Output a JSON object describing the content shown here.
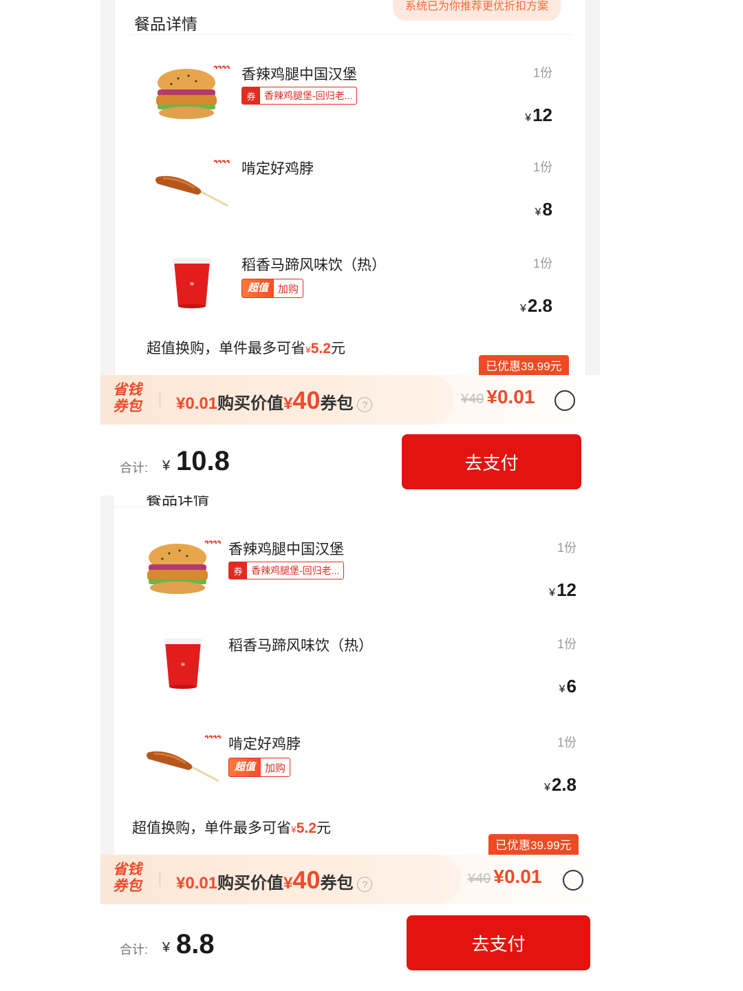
{
  "screen1": {
    "section_title": "餐品详情",
    "recommend_banner": "系统已为你推荐更优折扣方案",
    "items": [
      {
        "name": "香辣鸡腿中国汉堡",
        "qty": "1份",
        "price": "12",
        "tag": {
          "type": "coupon",
          "badge": "券",
          "text": "香辣鸡腿堡-回归老..."
        },
        "image": "burger"
      },
      {
        "name": "啃定好鸡脖",
        "qty": "1份",
        "price": "8",
        "image": "chicken-neck"
      },
      {
        "name": "稻香马蹄风味饮（热）",
        "qty": "1份",
        "price": "2.8",
        "tag": {
          "type": "value",
          "v": "超值",
          "a": "加购"
        },
        "image": "cup"
      }
    ],
    "swap_note": {
      "pre": "超值换购，单件最多可省",
      "yen": "¥",
      "amount": "5.2",
      "post": "元"
    },
    "discount_badge": "已优惠39.99元",
    "bundle": {
      "logo": "省钱券包",
      "t1": "¥0.01",
      "t2": "购买价值",
      "t3": "¥",
      "t4": "40",
      "t5": "券包",
      "help": "?",
      "old_price": "¥40",
      "price": "¥0.01"
    },
    "total_label": "合计:",
    "total_yen": "¥",
    "total_value": "10.8",
    "pay_button": "去支付"
  },
  "screen2": {
    "section_title": "餐品详情",
    "items": [
      {
        "name": "香辣鸡腿中国汉堡",
        "qty": "1份",
        "price": "12",
        "tag": {
          "type": "coupon",
          "badge": "券",
          "text": "香辣鸡腿堡-回归老..."
        },
        "image": "burger"
      },
      {
        "name": "稻香马蹄风味饮（热）",
        "qty": "1份",
        "price": "6",
        "image": "cup"
      },
      {
        "name": "啃定好鸡脖",
        "qty": "1份",
        "price": "2.8",
        "tag": {
          "type": "value",
          "v": "超值",
          "a": "加购"
        },
        "image": "chicken-neck"
      }
    ],
    "swap_note": {
      "pre": "超值换购，单件最多可省",
      "yen": "¥",
      "amount": "5.2",
      "post": "元"
    },
    "discount_badge": "已优惠39.99元",
    "bundle": {
      "logo": "省钱券包",
      "t1": "¥0.01",
      "t2": "购买价值",
      "t3": "¥",
      "t4": "40",
      "t5": "券包",
      "help": "?",
      "old_price": "¥40",
      "price": "¥0.01"
    },
    "total_label": "合计:",
    "total_yen": "¥",
    "total_value": "8.8",
    "pay_button": "去支付"
  },
  "colors": {
    "brand_red": "#e3130f",
    "accent_orange": "#f04a2a",
    "muted": "#9a9a9a"
  }
}
